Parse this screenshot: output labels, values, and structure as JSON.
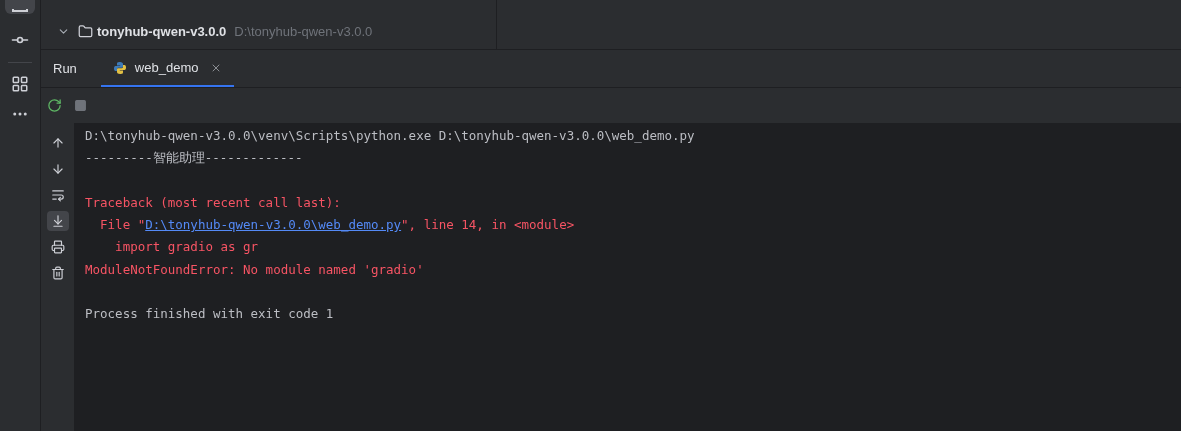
{
  "project_panel": {
    "root": {
      "name": "tonyhub-qwen-v3.0.0",
      "path": "D:\\tonyhub-qwen-v3.0.0",
      "expanded": true
    }
  },
  "run_tabs": {
    "label": "Run",
    "tabs": [
      {
        "label": "web_demo",
        "selected": true
      }
    ]
  },
  "console_gutter": [
    {
      "kind": "up",
      "on": false
    },
    {
      "kind": "down",
      "on": false
    },
    {
      "kind": "wrap",
      "on": false
    },
    {
      "kind": "scroll-end",
      "on": true
    },
    {
      "kind": "print",
      "on": false
    },
    {
      "kind": "trash",
      "on": false
    }
  ],
  "console": [
    {
      "kind": "output",
      "segments": [
        {
          "text": "D:\\tonyhub-qwen-v3.0.0\\venv\\Scripts\\python.exe D:\\tonyhub-qwen-v3.0.0\\web_demo.py",
          "kind": "plain"
        }
      ]
    },
    {
      "kind": "output",
      "segments": [
        {
          "text": "---------智能助理-------------",
          "kind": "plain"
        }
      ]
    },
    {
      "kind": "blank"
    },
    {
      "kind": "error",
      "segments": [
        {
          "text": "Traceback (most recent call last):",
          "kind": "plain"
        }
      ]
    },
    {
      "kind": "error",
      "segments": [
        {
          "text": "  File \"",
          "kind": "plain"
        },
        {
          "text": "D:\\tonyhub-qwen-v3.0.0\\web_demo.py",
          "kind": "link"
        },
        {
          "text": "\", line 14, in <module>",
          "kind": "plain"
        }
      ]
    },
    {
      "kind": "error",
      "segments": [
        {
          "text": "    import gradio as gr",
          "kind": "plain"
        }
      ]
    },
    {
      "kind": "error",
      "segments": [
        {
          "text": "ModuleNotFoundError: No module named 'gradio'",
          "kind": "plain"
        }
      ]
    },
    {
      "kind": "blank"
    },
    {
      "kind": "output",
      "segments": [
        {
          "text": "Process finished with exit code 1",
          "kind": "plain"
        }
      ]
    }
  ]
}
